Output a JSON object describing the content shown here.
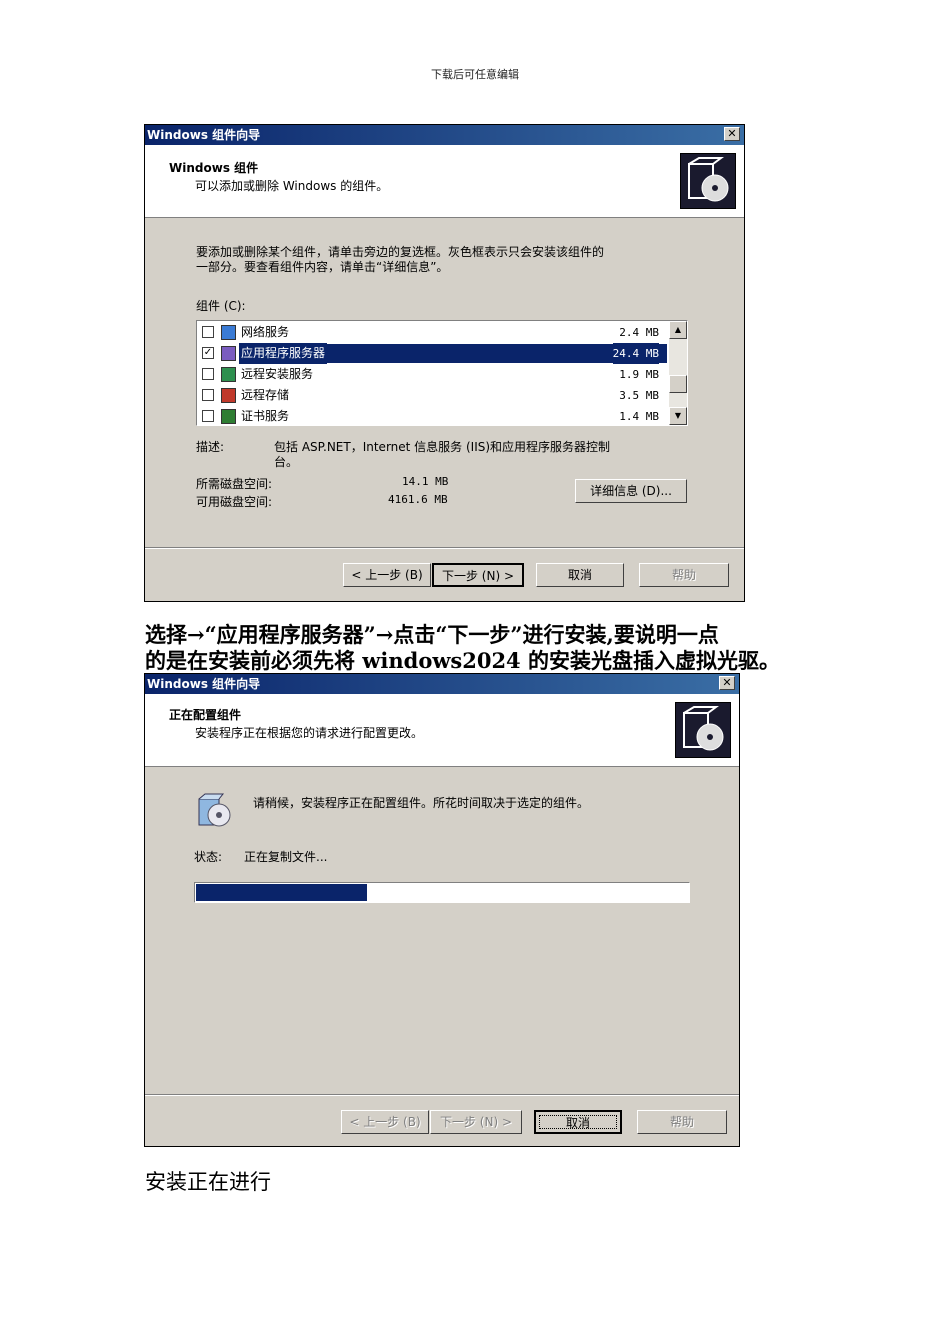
{
  "page_header": "下载后可任意编辑",
  "dialog1": {
    "title": "Windows 组件向导",
    "header_title": "Windows 组件",
    "header_sub": "可以添加或删除 Windows 的组件。",
    "instruction_line1": "要添加或删除某个组件，请单击旁边的复选框。灰色框表示只会安装该组件的",
    "instruction_line2": "一部分。要查看组件内容，请单击“详细信息”。",
    "components_label": "组件 (C):",
    "components": [
      {
        "name": "网络服务",
        "size": "2.4 MB",
        "checked": false,
        "selected": false,
        "icon": "network-icon"
      },
      {
        "name": "应用程序服务器",
        "size": "24.4 MB",
        "checked": true,
        "selected": true,
        "icon": "app-server-icon"
      },
      {
        "name": "远程安装服务",
        "size": "1.9 MB",
        "checked": false,
        "selected": false,
        "icon": "remote-install-icon"
      },
      {
        "name": "远程存储",
        "size": "3.5 MB",
        "checked": false,
        "selected": false,
        "icon": "remote-storage-icon"
      },
      {
        "name": "证书服务",
        "size": "1.4 MB",
        "checked": false,
        "selected": false,
        "icon": "certificate-icon"
      }
    ],
    "desc_label": "描述:",
    "desc_line1": "包括 ASP.NET，Internet 信息服务 (IIS)和应用程序服务器控制",
    "desc_line2": "台。",
    "required_label": "所需磁盘空间:",
    "required_value": "14.1 MB",
    "available_label": "可用磁盘空间:",
    "available_value": "4161.6 MB",
    "details_button": "详细信息 (D)...",
    "back_button": "< 上一步 (B)",
    "next_button": "下一步 (N) >",
    "cancel_button": "取消",
    "help_button": "帮助"
  },
  "caption1_line1": "选择→“应用程序服务器”→点击“下一步”进行安装,要说明一点",
  "caption1_line2": "的是在安装前必须先将 windows2024 的安装光盘插入虚拟光驱。",
  "dialog2": {
    "title": "Windows 组件向导",
    "header_title": "正在配置组件",
    "header_sub": "安装程序正在根据您的请求进行配置更改。",
    "wait_text": "请稍候，安装程序正在配置组件。所花时间取决于选定的组件。",
    "status_label": "状态:",
    "status_value": "正在复制文件...",
    "progress_fraction": 0.35,
    "back_button": "< 上一步 (B)",
    "next_button": "下一步 (N) >",
    "cancel_button": "取消",
    "help_button": "帮助"
  },
  "caption2": "安装正在进行"
}
